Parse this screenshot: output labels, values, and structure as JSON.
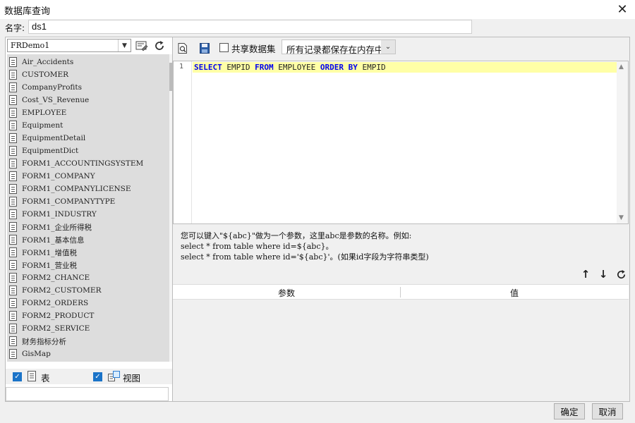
{
  "window": {
    "title": "数据库查询"
  },
  "name_field": {
    "label": "名字:",
    "value": "ds1"
  },
  "connection": {
    "selected": "FRDemo1"
  },
  "tables": [
    "Air_Accidents",
    "CUSTOMER",
    "CompanyProfits",
    "Cost_VS_Revenue",
    "EMPLOYEE",
    "Equipment",
    "EquipmentDetail",
    "EquipmentDict",
    "FORM1_ACCOUNTINGSYSTEM",
    "FORM1_COMPANY",
    "FORM1_COMPANYLICENSE",
    "FORM1_COMPANYTYPE",
    "FORM1_INDUSTRY",
    "FORM1_企业所得税",
    "FORM1_基本信息",
    "FORM1_增值税",
    "FORM1_营业税",
    "FORM2_CHANCE",
    "FORM2_CUSTOMER",
    "FORM2_ORDERS",
    "FORM2_PRODUCT",
    "FORM2_SERVICE",
    "财务指标分析",
    "GisMap"
  ],
  "filters": {
    "table_label": "表",
    "table_checked": true,
    "view_label": "视图",
    "view_checked": true
  },
  "toolbar": {
    "share_label": "共享数据集",
    "mode_value": "所有记录都保存在内存中"
  },
  "sql": {
    "line_number": "1",
    "tokens": [
      {
        "t": "SELECT",
        "kw": true
      },
      {
        "t": " EMPID ",
        "kw": false
      },
      {
        "t": "FROM",
        "kw": true
      },
      {
        "t": " EMPLOYEE ",
        "kw": false
      },
      {
        "t": "ORDER BY",
        "kw": true
      },
      {
        "t": " EMPID",
        "kw": false
      }
    ]
  },
  "hint": {
    "line1": "您可以键入\"${abc}\"做为一个参数，这里abc是参数的名称。例如:",
    "line2": "select * from table where id=${abc}。",
    "line3": "select * from table where id='${abc}'。(如果id字段为字符串类型)"
  },
  "params": {
    "col_param": "参数",
    "col_value": "值"
  },
  "buttons": {
    "ok": "确定",
    "cancel": "取消"
  },
  "colors": {
    "keyword": "#0000ee",
    "highlight_line": "#ffffa6",
    "checkbox": "#1a73c8"
  }
}
